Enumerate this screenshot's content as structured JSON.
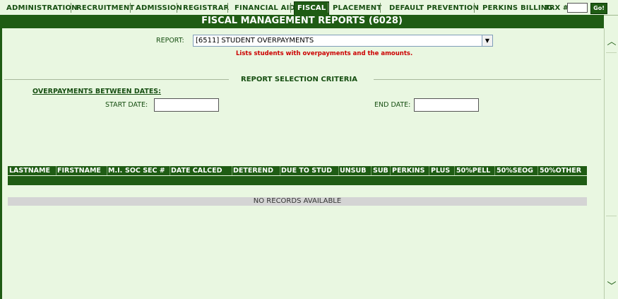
{
  "nav": {
    "items": [
      "ADMINISTRATION",
      "RECRUITMENT",
      "ADMISSION",
      "REGISTRAR",
      "FINANCIAL AID",
      "FISCAL",
      "PLACEMENT",
      "DEFAULT PREVENTION",
      "PERKINS BILLING"
    ],
    "active": "FISCAL",
    "trx_label": "TRX #:",
    "trx_value": "",
    "go_label": "Go!"
  },
  "page": {
    "title": "FISCAL MANAGEMENT REPORTS (6028)"
  },
  "report": {
    "label": "REPORT:",
    "selected": "[6511] STUDENT OVERPAYMENTS",
    "description": "Lists students with overpayments and the amounts."
  },
  "criteria": {
    "title": "REPORT SELECTION CRITERIA",
    "between_dates": "OVERPAYMENTS BETWEEN DATES:",
    "start_label": "START DATE:",
    "start_value": "",
    "end_label": "END DATE:",
    "end_value": ""
  },
  "table": {
    "columns": [
      "LASTNAME",
      "FIRSTNAME",
      "M.I.",
      "SOC SEC #",
      "DATE CALCED",
      "DETEREND",
      "DUE TO STUD",
      "UNSUB",
      "SUB",
      "PERKINS",
      "PLUS",
      "50%PELL",
      "50%SEOG",
      "50%OTHER"
    ],
    "empty_message": "NO RECORDS AVAILABLE"
  },
  "colors": {
    "accent": "#1f5c14",
    "background": "#e9f7e1",
    "description_red": "#cc0000"
  }
}
